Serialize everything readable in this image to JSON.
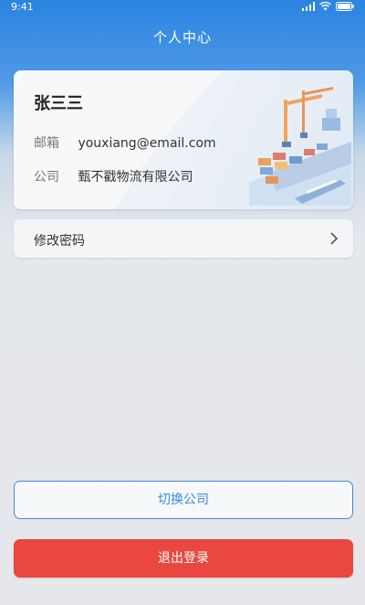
{
  "status": {
    "time": "9:41"
  },
  "header": {
    "title": "个人中心"
  },
  "profile": {
    "name": "张三三",
    "email_label": "邮箱",
    "email": "youxiang@email.com",
    "company_label": "公司",
    "company": "甄不戳物流有限公司"
  },
  "menu": {
    "change_password": "修改密码"
  },
  "actions": {
    "switch_company": "切换公司",
    "logout": "退出登录"
  },
  "colors": {
    "header_blue": "#2b84e0",
    "accent_blue": "#3a8ae0",
    "logout_red": "#e9473f"
  },
  "icons": [
    "signal-icon",
    "wifi-icon",
    "battery-icon",
    "chevron-right-icon",
    "port-illustration"
  ]
}
